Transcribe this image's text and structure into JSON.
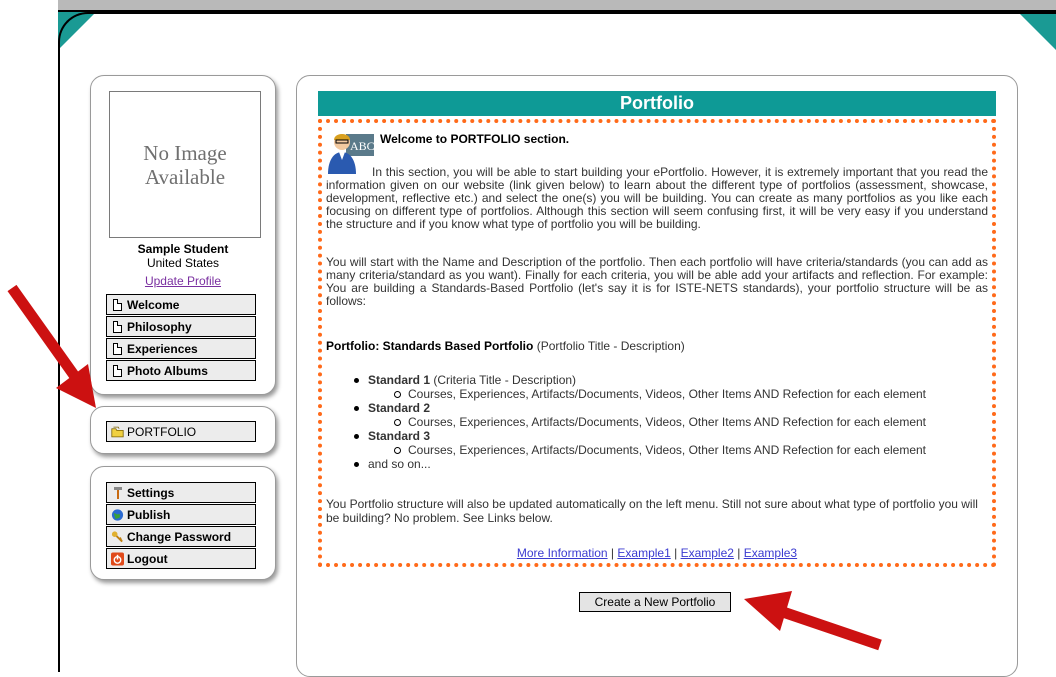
{
  "profile": {
    "photo_placeholder": "No Image Available",
    "name": "Sample Student",
    "country": "United States",
    "update_link": "Update Profile"
  },
  "sidebar": {
    "pages": [
      {
        "label": "Welcome",
        "icon": "document-icon"
      },
      {
        "label": "Philosophy",
        "icon": "document-icon"
      },
      {
        "label": "Experiences",
        "icon": "document-icon"
      },
      {
        "label": "Photo Albums",
        "icon": "document-icon"
      }
    ],
    "portfolio": {
      "label": "PORTFOLIO",
      "icon": "folder-icon"
    },
    "account": [
      {
        "label": "Settings",
        "icon": "tools-icon"
      },
      {
        "label": "Publish",
        "icon": "globe-icon"
      },
      {
        "label": "Change Password",
        "icon": "key-icon"
      },
      {
        "label": "Logout",
        "icon": "power-icon"
      }
    ]
  },
  "main": {
    "title": "Portfolio",
    "welcome_heading": "Welcome to PORTFOLIO section.",
    "intro_paragraph": "In this section, you will be able to start building your ePortfolio. However, it is extremely important that you read the information given on our website (link given below) to learn about the different type of portfolios (assessment, showcase, development, reflective etc.) and select the one(s) you will be building. You can create as many portfolios as you like each focusing on different type of portfolios. Although this section will seem confusing first, it will be very easy if you understand the structure and if you know what type of portfolio you will be building.",
    "structure_paragraph": "You will start with the Name and Description of the portfolio. Then each portfolio will have criteria/standards (you can add as many criteria/standard as you want). Finally for each criteria, you will be able add your artifacts and reflection. For example: You are building a Standards-Based Portfolio (let's say it is for ISTE-NETS standards), your portfolio structure will be as follows:",
    "portfolio_line_bold": "Portfolio: Standards Based Portfolio",
    "portfolio_line_rest": " (Portfolio Title - Description)",
    "standards": [
      {
        "bold": "Standard 1",
        "rest": " (Criteria Title - Description)",
        "sub": "Courses, Experiences, Artifacts/Documents, Videos, Other Items AND Refection for each element"
      },
      {
        "bold": "Standard 2",
        "rest": "",
        "sub": "Courses, Experiences, Artifacts/Documents, Videos, Other Items AND Refection for each element"
      },
      {
        "bold": "Standard 3",
        "rest": "",
        "sub": "Courses, Experiences, Artifacts/Documents, Videos, Other Items AND Refection for each element"
      }
    ],
    "and_so_on": "and so on...",
    "closing_paragraph": "You Portfolio structure will also be updated automatically on the left menu. Still not sure about what type of portfolio you will be building? No problem. See Links below.",
    "links": [
      "More Information",
      "Example1",
      "Example2",
      "Example3"
    ],
    "link_separator": " | ",
    "create_button": "Create a New Portfolio"
  },
  "colors": {
    "teal": "#0e9a96",
    "dotted_border": "#ff6a1a",
    "arrow": "#cc1111",
    "link_visited": "#7a2fa0",
    "link": "#3b3bd0"
  }
}
